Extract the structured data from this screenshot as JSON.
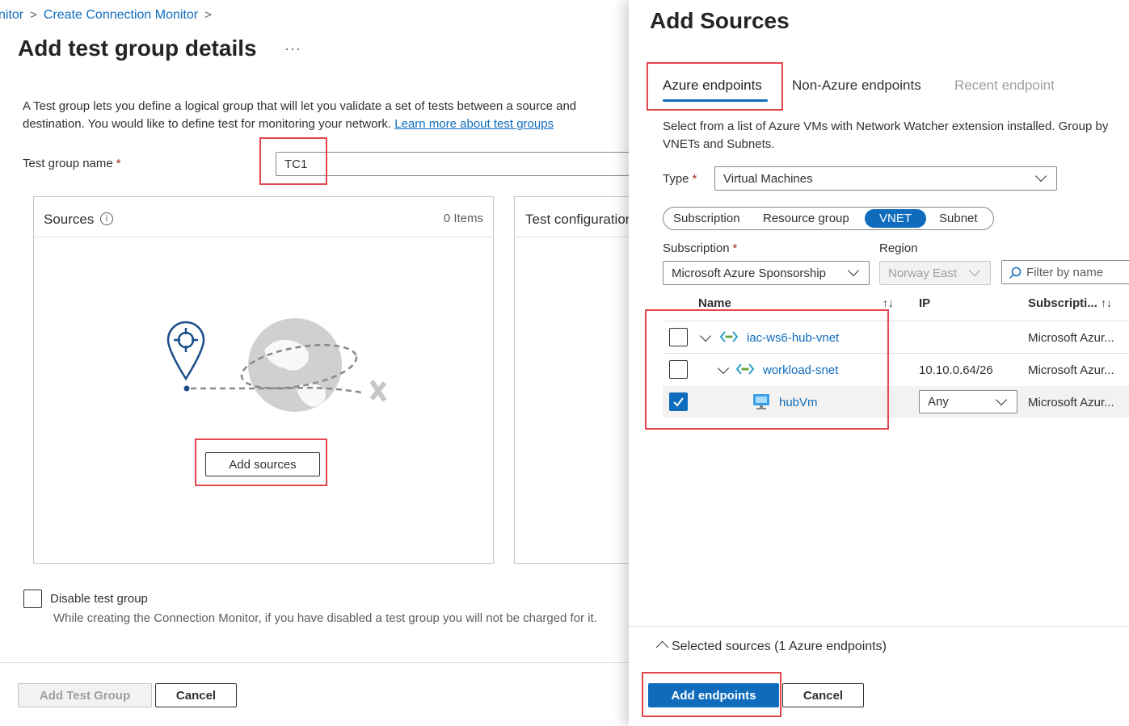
{
  "breadcrumb": {
    "item1": "nitor",
    "item2": "Create Connection Monitor"
  },
  "page": {
    "title": "Add test group details",
    "more": "···",
    "description": "A Test group lets you define a logical group that will let you validate a set of tests between a source and destination. You would like to define test for monitoring your network.",
    "learn_more": "Learn more about test groups",
    "test_group_name_label": "Test group name",
    "required_mark": "*",
    "test_group_name_value": "TC1"
  },
  "sources_card": {
    "title": "Sources",
    "info": "i",
    "count": "0 Items",
    "add_button": "Add sources"
  },
  "test_config_card": {
    "title": "Test configurations"
  },
  "disable": {
    "label": "Disable test group",
    "help": "While creating the Connection Monitor, if you have disabled a test group you will not be charged for it."
  },
  "footer": {
    "add_test_group": "Add Test Group",
    "cancel": "Cancel"
  },
  "panel": {
    "title": "Add Sources",
    "tabs": [
      "Azure endpoints",
      "Non-Azure endpoints",
      "Recent endpoint"
    ],
    "description": "Select from a list of Azure VMs with Network Watcher extension installed. Group by VNETs and Subnets.",
    "type_label": "Type",
    "type_value": "Virtual Machines",
    "pivots": [
      "Subscription",
      "Resource group",
      "VNET",
      "Subnet"
    ],
    "subscription_label": "Subscription",
    "subscription_value": "Microsoft Azure Sponsorship",
    "region_label": "Region",
    "region_value": "Norway East",
    "filter_placeholder": "Filter by name",
    "columns": {
      "name": "Name",
      "ip": "IP",
      "subscription": "Subscripti..."
    },
    "sort_icon": "↑↓",
    "rows": [
      {
        "name": "iac-ws6-hub-vnet",
        "ip": "",
        "subscription": "Microsoft Azur...",
        "checked": false
      },
      {
        "name": "workload-snet",
        "ip": "10.10.0.64/26",
        "subscription": "Microsoft Azur...",
        "checked": false
      },
      {
        "name": "hubVm",
        "ip": "Any",
        "subscription": "Microsoft Azur...",
        "checked": true
      }
    ],
    "selected_sources": "Selected sources (1 Azure endpoints)",
    "add_endpoints": "Add endpoints",
    "cancel": "Cancel"
  },
  "colors": {
    "accent": "#0f6cbd",
    "highlight": "#e3464c"
  }
}
